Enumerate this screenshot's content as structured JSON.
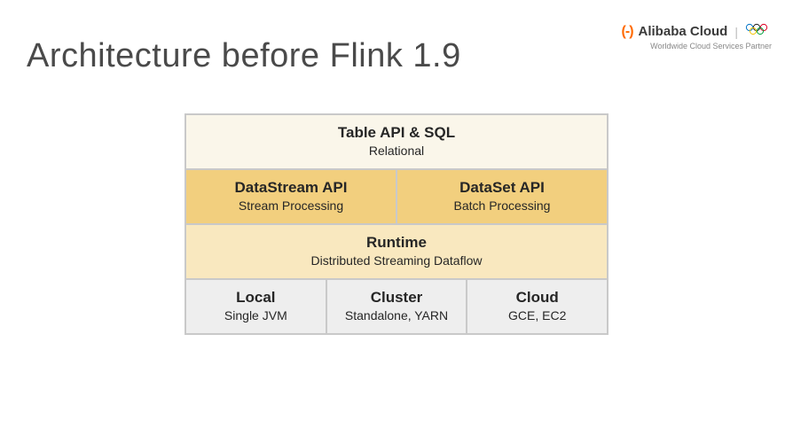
{
  "header": {
    "title": "Architecture before Flink 1.9",
    "brand_bracket": "(-)",
    "brand_name": "Alibaba Cloud",
    "tagline": "Worldwide Cloud Services Partner"
  },
  "diagram": {
    "top": {
      "title": "Table API & SQL",
      "sub": "Relational"
    },
    "apis": [
      {
        "title": "DataStream API",
        "sub": "Stream Processing"
      },
      {
        "title": "DataSet API",
        "sub": "Batch Processing"
      }
    ],
    "runtime": {
      "title": "Runtime",
      "sub": "Distributed Streaming Dataflow"
    },
    "deploy": [
      {
        "title": "Local",
        "sub": "Single JVM"
      },
      {
        "title": "Cluster",
        "sub": "Standalone, YARN"
      },
      {
        "title": "Cloud",
        "sub": "GCE, EC2"
      }
    ]
  }
}
